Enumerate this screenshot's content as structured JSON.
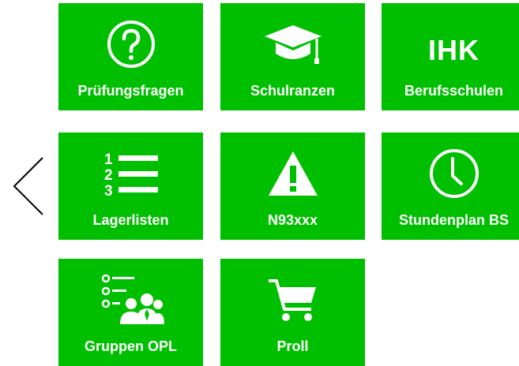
{
  "navigation": {
    "back_icon": "chevron-left-icon"
  },
  "theme": {
    "tile_color": "#00bf00",
    "text_color": "#ffffff"
  },
  "tiles": [
    {
      "label": "Prüfungsfragen",
      "icon": "question-circle-icon"
    },
    {
      "label": "Schulranzen",
      "icon": "graduation-cap-icon"
    },
    {
      "label": "Berufsschulen",
      "icon": "ihk-text-icon",
      "icon_text": "IHK"
    },
    {
      "label": "Lagerlisten",
      "icon": "numbered-list-icon"
    },
    {
      "label": "N93xxx",
      "icon": "warning-triangle-icon"
    },
    {
      "label": "Stundenplan BS",
      "icon": "clock-icon"
    },
    {
      "label": "Gruppen OPL",
      "icon": "group-list-icon"
    },
    {
      "label": "Proll",
      "icon": "shopping-cart-icon"
    }
  ]
}
